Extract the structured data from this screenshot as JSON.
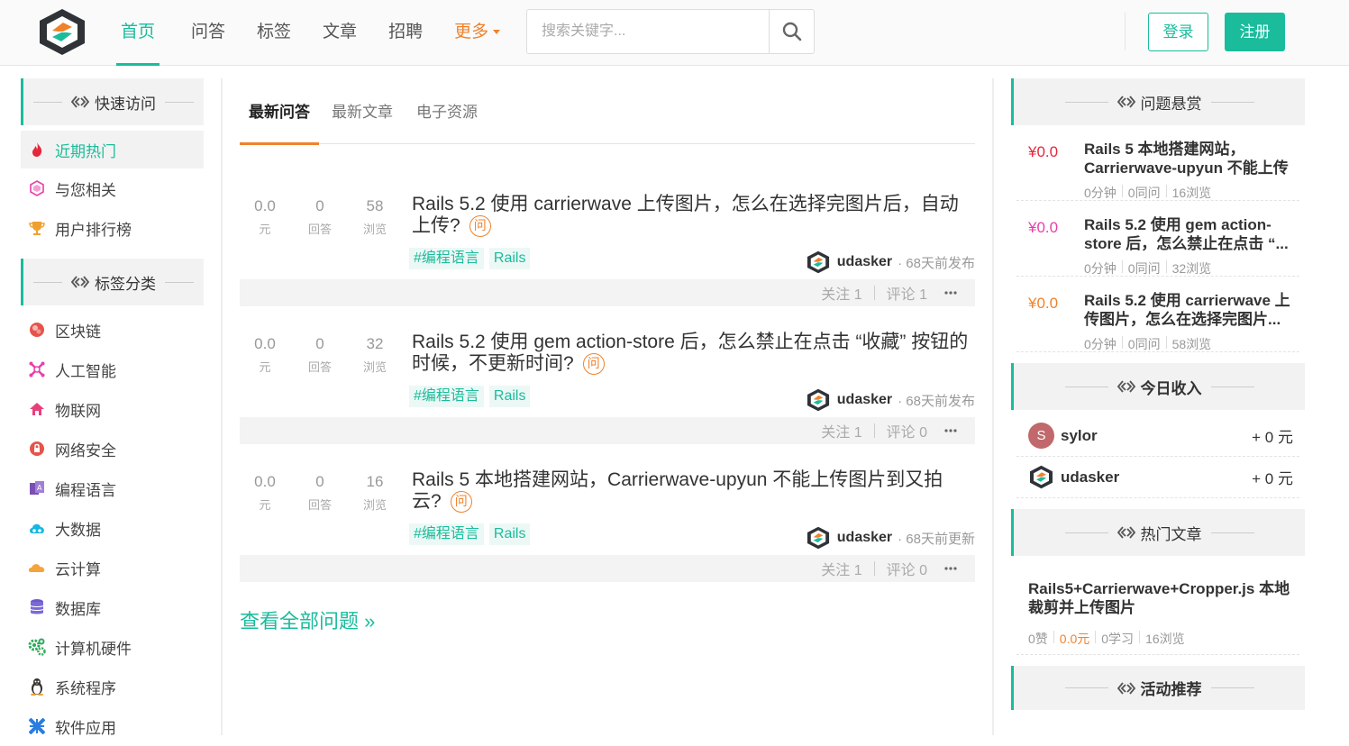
{
  "header": {
    "nav": [
      "首页",
      "问答",
      "标签",
      "文章",
      "招聘"
    ],
    "more": "更多",
    "search_placeholder": "搜索关键字...",
    "login": "登录",
    "register": "注册"
  },
  "left": {
    "quick_access_title": "快速访问",
    "quick_items": [
      {
        "label": "近期热门",
        "icon": "fire-icon"
      },
      {
        "label": "与您相关",
        "icon": "hexagon-icon"
      },
      {
        "label": "用户排行榜",
        "icon": "trophy-icon"
      }
    ],
    "tags_title": "标签分类",
    "tag_items": [
      {
        "label": "区块链",
        "icon": "blockchain-icon"
      },
      {
        "label": "人工智能",
        "icon": "ai-icon"
      },
      {
        "label": "物联网",
        "icon": "home-icon"
      },
      {
        "label": "网络安全",
        "icon": "lock-icon"
      },
      {
        "label": "编程语言",
        "icon": "code-icon"
      },
      {
        "label": "大数据",
        "icon": "bigdata-icon"
      },
      {
        "label": "云计算",
        "icon": "cloud-icon"
      },
      {
        "label": "数据库",
        "icon": "database-icon"
      },
      {
        "label": "计算机硬件",
        "icon": "gears-icon"
      },
      {
        "label": "系统程序",
        "icon": "penguin-icon"
      },
      {
        "label": "软件应用",
        "icon": "app-icon"
      }
    ]
  },
  "main": {
    "tabs": [
      "最新问答",
      "最新文章",
      "电子资源"
    ],
    "stat_labels": {
      "money": "元",
      "answers": "回答",
      "views": "浏览"
    },
    "wen": "问",
    "questions": [
      {
        "money": "0.0",
        "answers": "0",
        "views": "58",
        "title": "Rails 5.2 使用 carrierwave 上传图片，怎么在选择完图片后，自动上传?",
        "tags": [
          "#编程语言",
          "Rails"
        ],
        "author": "udasker",
        "time": "· 68天前发布",
        "follow": "关注 1",
        "comment": "评论 1"
      },
      {
        "money": "0.0",
        "answers": "0",
        "views": "32",
        "title": "Rails 5.2 使用 gem action-store 后，怎么禁止在点击 “收藏” 按钮的时候，不更新时间?",
        "tags": [
          "#编程语言",
          "Rails"
        ],
        "author": "udasker",
        "time": "· 68天前发布",
        "follow": "关注 1",
        "comment": "评论 0"
      },
      {
        "money": "0.0",
        "answers": "0",
        "views": "16",
        "title": "Rails 5 本地搭建网站，Carrierwave-upyun 不能上传图片到又拍云?",
        "tags": [
          "#编程语言",
          "Rails"
        ],
        "author": "udasker",
        "time": "· 68天前更新",
        "follow": "关注 1",
        "comment": "评论 0"
      }
    ],
    "view_all": "查看全部问题 »"
  },
  "right": {
    "reward_title": "问题悬赏",
    "rewards": [
      {
        "price": "¥0.0",
        "color": "#e5263b",
        "title": "Rails 5 本地搭建网站，Carrierwave-upyun 不能上传图片...",
        "time": "0分钟",
        "same": "0同问",
        "views": "16浏览"
      },
      {
        "price": "¥0.0",
        "color": "#e83fa7",
        "title": "Rails 5.2 使用 gem action-store 后，怎么禁止在点击 “...",
        "time": "0分钟",
        "same": "0同问",
        "views": "32浏览"
      },
      {
        "price": "¥0.0",
        "color": "#f0822c",
        "title": "Rails 5.2 使用 carrierwave 上传图片，怎么在选择完图片...",
        "time": "0分钟",
        "same": "0同问",
        "views": "58浏览"
      }
    ],
    "income_title": "今日收入",
    "incomes": [
      {
        "name": "sylor",
        "amount": "+ 0 元",
        "initial": "S"
      },
      {
        "name": "udasker",
        "amount": "+ 0 元"
      }
    ],
    "articles_title": "热门文章",
    "article": {
      "title": "Rails5+Carrierwave+Cropper.js 本地裁剪并上传图片",
      "likes": "0赞",
      "money": "0.0元",
      "learn": "0学习",
      "views": "16浏览"
    },
    "activity_title": "活动推荐"
  },
  "colors": {
    "accent": "#1abc9c",
    "orange": "#f0822c"
  }
}
